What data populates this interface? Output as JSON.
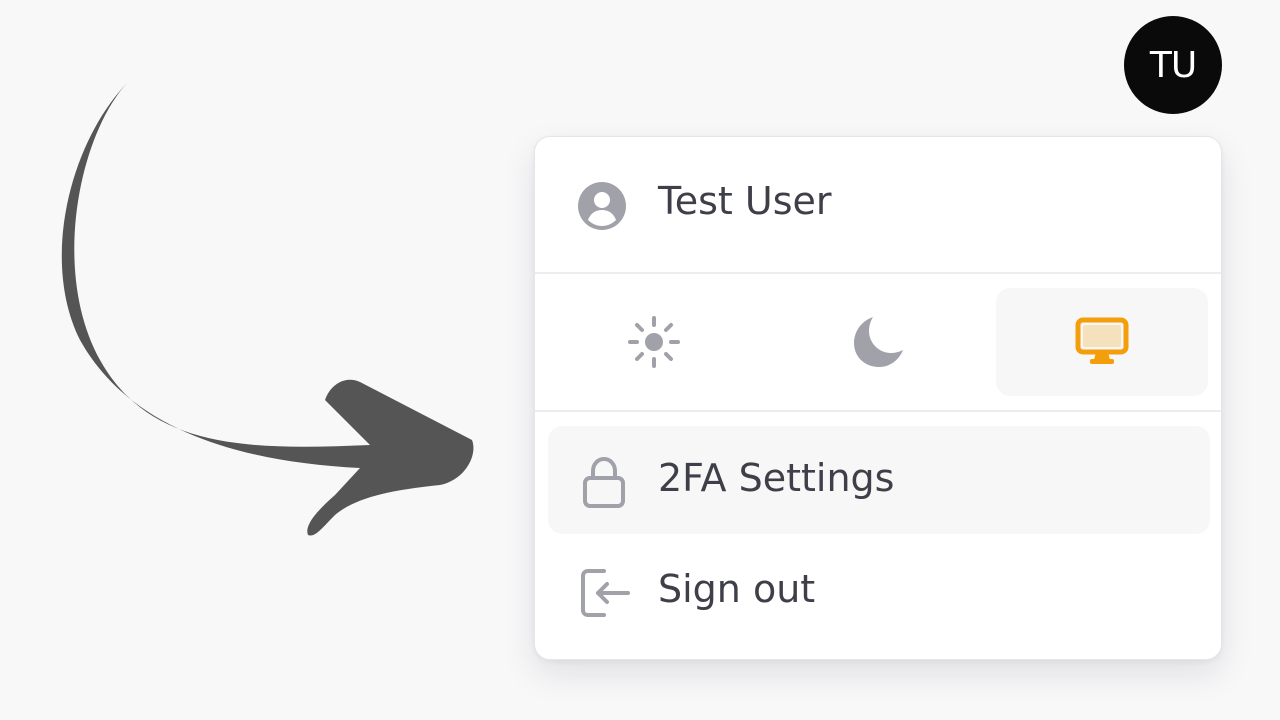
{
  "avatar": {
    "initials": "TU"
  },
  "menu": {
    "user_name": "Test User",
    "theme_options": [
      {
        "name": "light",
        "icon": "sun-icon",
        "selected": false
      },
      {
        "name": "dark",
        "icon": "moon-icon",
        "selected": false
      },
      {
        "name": "system",
        "icon": "monitor-icon",
        "selected": true
      }
    ],
    "items": [
      {
        "label": "2FA Settings",
        "icon": "lock-icon"
      },
      {
        "label": "Sign out",
        "icon": "sign-out-icon"
      }
    ]
  },
  "colors": {
    "accent": "#f59e0b",
    "icon_gray": "#a1a1aa",
    "text": "#3f3f4a",
    "avatar_bg": "#0a0a0a"
  }
}
